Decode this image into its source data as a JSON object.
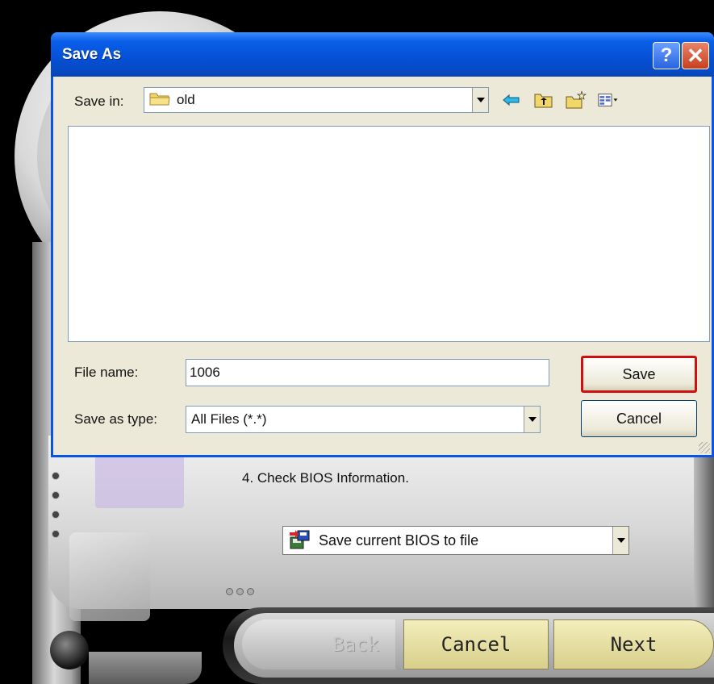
{
  "dialog": {
    "title": "Save As",
    "help_button": "?",
    "close_button": "✕",
    "save_in_label": "Save in:",
    "save_in_value": "old",
    "file_name_label": "File name:",
    "file_name_value": "1006",
    "save_as_type_label": "Save as type:",
    "save_as_type_value": "All Files (*.*)",
    "save_button": "Save",
    "cancel_button": "Cancel",
    "toolbar_icons": [
      "back-arrow-icon",
      "up-one-level-icon",
      "new-folder-icon",
      "view-menu-icon"
    ]
  },
  "utility": {
    "step_text": "4. Check BIOS Information.",
    "action_select_value": "Save current BIOS to file",
    "nav": {
      "back_label": "Back",
      "cancel_label": "Cancel",
      "next_label": "Next"
    }
  },
  "colors": {
    "titlebar_blue": "#0550d6",
    "dialog_bg": "#ece9d8",
    "save_highlight": "#d01010",
    "nav_button": "#e9e2a8"
  }
}
